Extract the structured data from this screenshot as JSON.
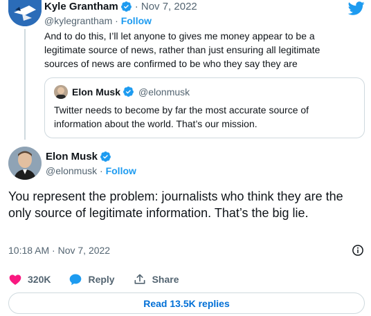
{
  "parent_tweet": {
    "author_name": "Kyle Grantham",
    "date": "· Nov 7, 2022",
    "handle": "@kylegrantham ·",
    "follow_label": "Follow",
    "text": "And to do this, I’ll let anyone to gives me money appear to be a legitimate source of news, rather than just ensuring all legitimate sources of news are confirmed to be who they say they are"
  },
  "quoted_tweet": {
    "author_name": "Elon Musk",
    "handle": "@elonmusk",
    "text": "Twitter needs to become by far the most accurate source of information about the world. That’s our mission."
  },
  "main_tweet": {
    "author_name": "Elon Musk",
    "handle": "@elonmusk ·",
    "follow_label": "Follow",
    "text": "You represent the problem: journalists who think they are the only source of legitimate information. That’s the big lie.",
    "timestamp": "10:18 AM · Nov 7, 2022"
  },
  "actions": {
    "like_count": "320K",
    "reply_label": "Reply",
    "share_label": "Share"
  },
  "read_replies_label": "Read 13.5K replies",
  "colors": {
    "accent": "#1d9bf0",
    "like": "#f91880",
    "secondary_text": "#536471",
    "border": "#cfd9de"
  },
  "icons": [
    "twitter-bird-icon",
    "verified-badge-icon",
    "info-icon",
    "heart-icon",
    "reply-bubble-icon",
    "share-icon"
  ]
}
